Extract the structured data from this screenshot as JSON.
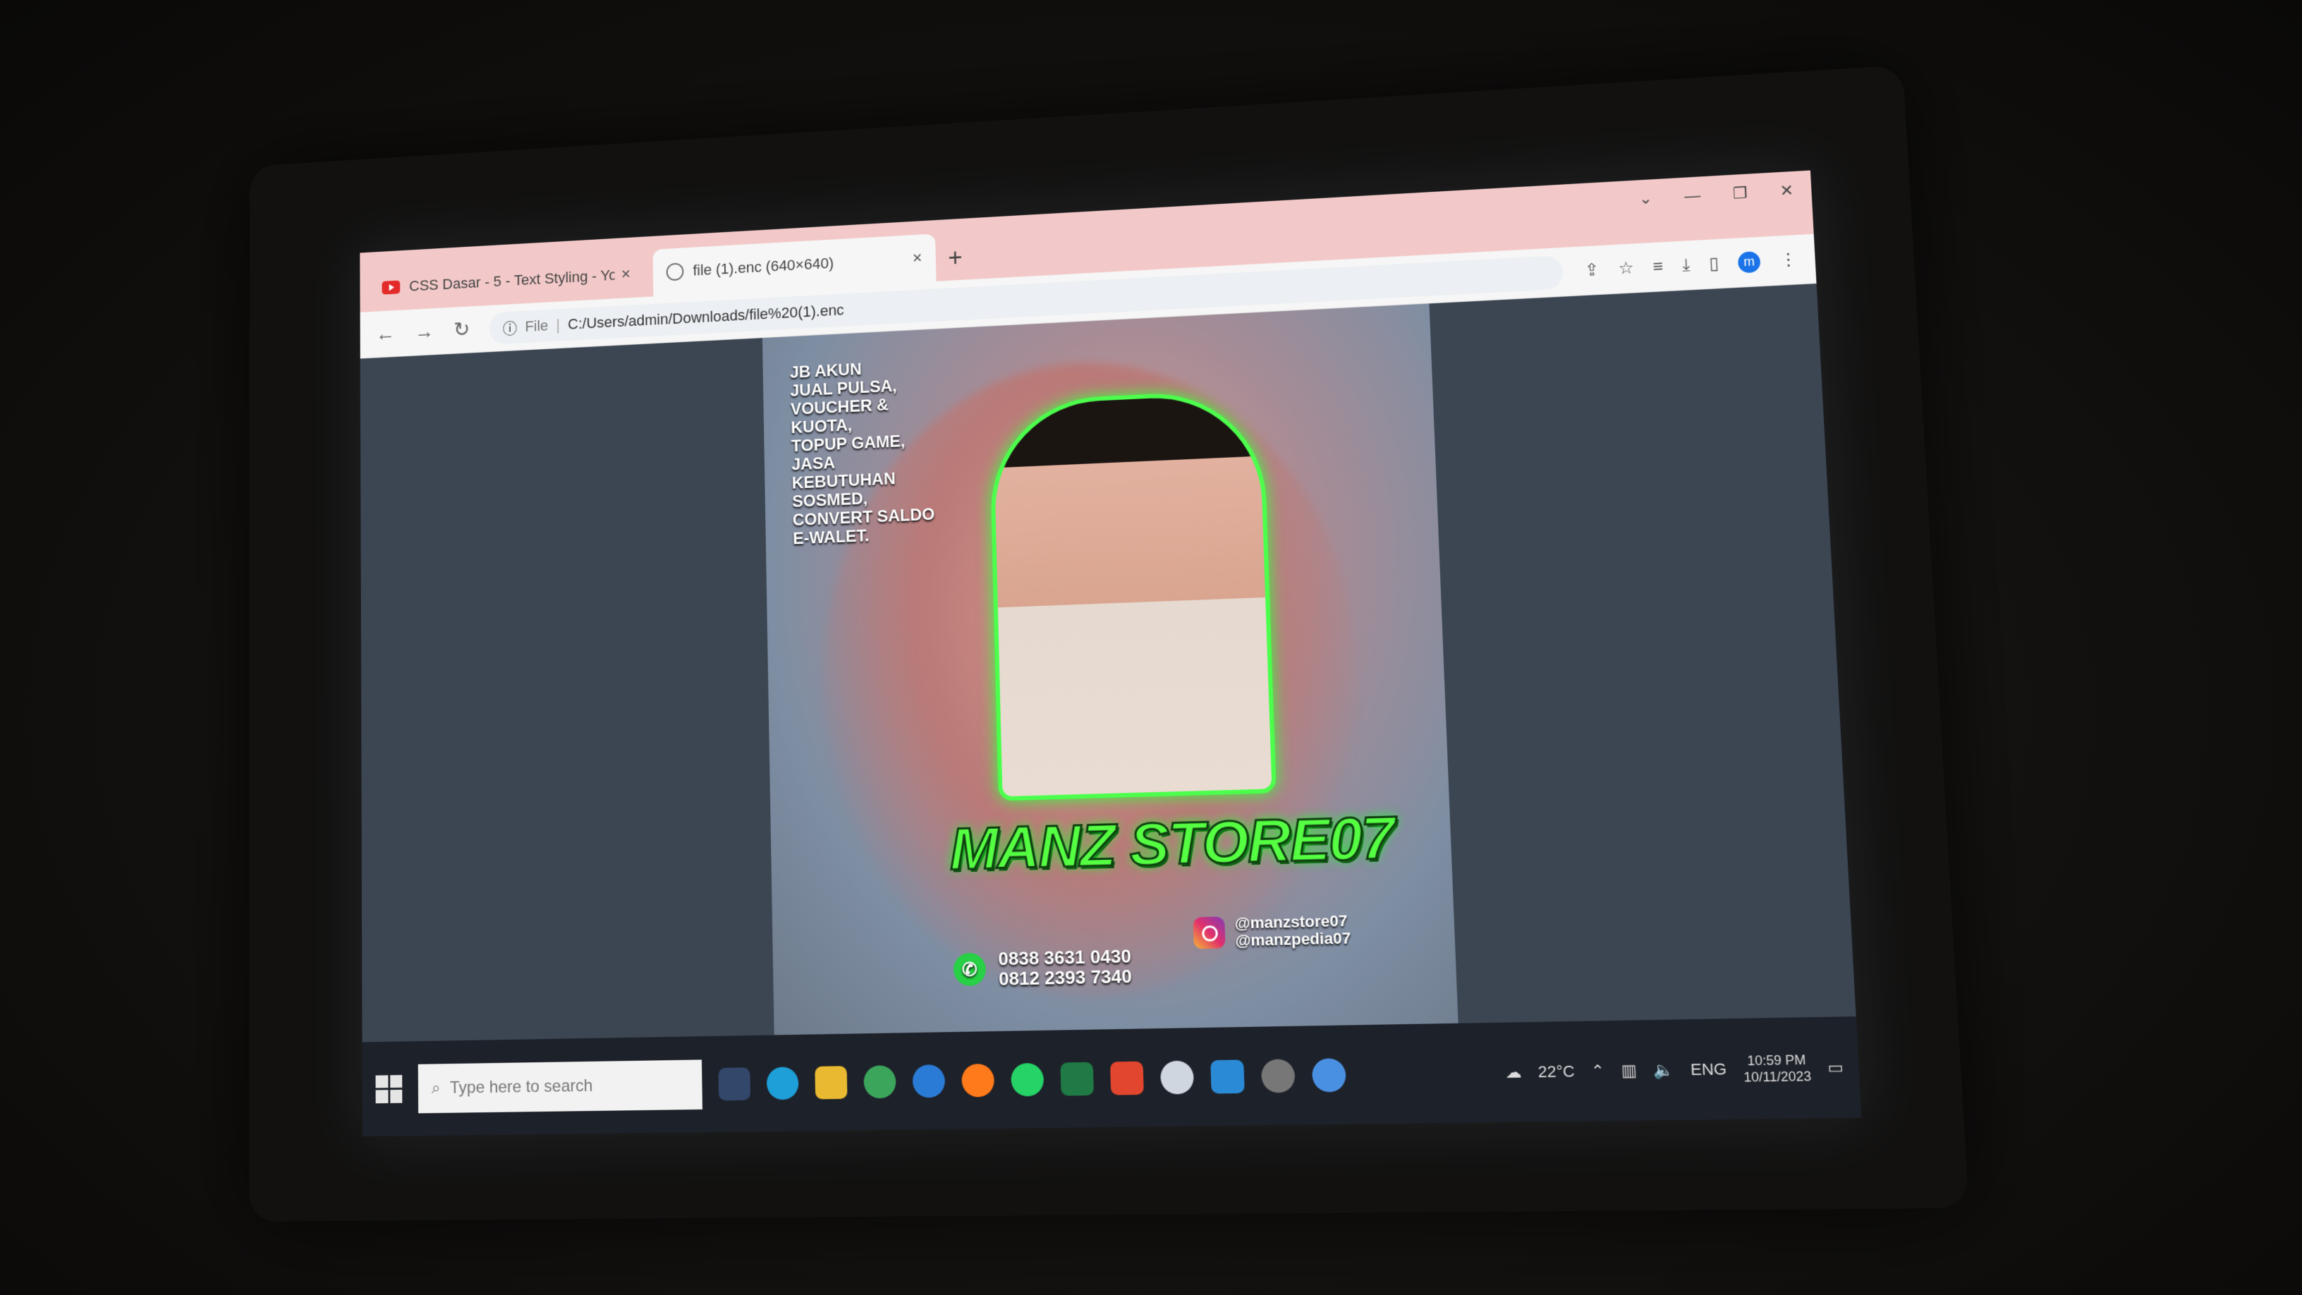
{
  "browser": {
    "tabs": [
      {
        "label": "CSS Dasar - 5 - Text Styling - Yo",
        "icon": "youtube-icon",
        "active": false
      },
      {
        "label": "file (1).enc (640×640)",
        "icon": "globe-icon",
        "active": true
      }
    ],
    "new_tab": "+",
    "close_glyph": "×",
    "address": {
      "scheme": "File",
      "url": "C:/Users/admin/Downloads/file%20(1).enc"
    },
    "profile_initial": "m"
  },
  "poster": {
    "promo_lines": [
      "JB AKUN",
      "JUAL PULSA,",
      "VOUCHER &",
      "KUOTA,",
      "TOPUP GAME,",
      "JASA KEBUTUHAN",
      "SOSMED,",
      "CONVERT SALDO",
      "E-WALET."
    ],
    "brand": "MANZ STORE07",
    "phone_1": "0838 3631 0430",
    "phone_2": "0812 2393 7340",
    "social_1": "@manzstore07",
    "social_2": "@manzpedia07"
  },
  "taskbar": {
    "search_placeholder": "Type here to search",
    "weather": "22°C",
    "lang": "ENG",
    "time": "10:59 PM",
    "date": "10/11/2023"
  },
  "colors": {
    "tabstrip": "#f2c9c8",
    "brand_green": "#55ff42",
    "taskbar": "#1d2129"
  }
}
